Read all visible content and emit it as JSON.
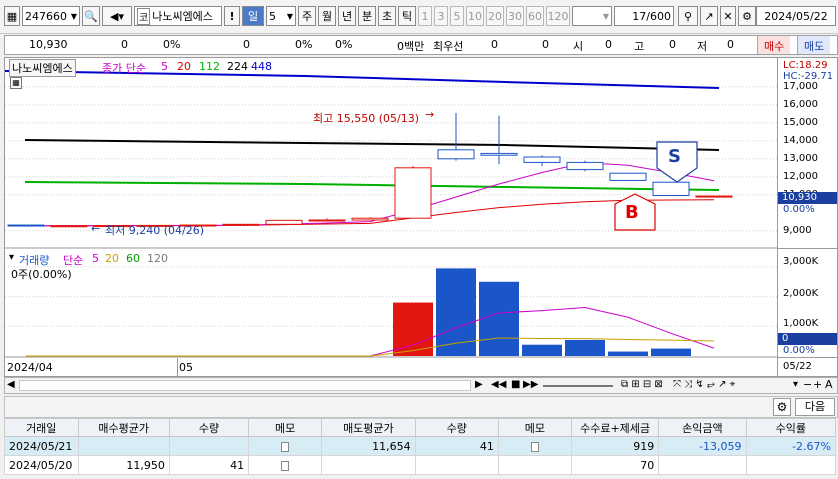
{
  "toolbar": {
    "code": "247660",
    "market": "코",
    "stock_name": "나노씨엠에스",
    "excl": "!",
    "period_sel": "일",
    "period_num": "5",
    "periods": [
      "주",
      "월",
      "년",
      "분",
      "초",
      "틱"
    ],
    "nums": [
      "1",
      "3",
      "5",
      "10",
      "20",
      "30",
      "60",
      "120"
    ],
    "count": "17",
    "count_total": "/600",
    "date": "2024/05/22"
  },
  "summary": {
    "price": "10,930",
    "v1": "0",
    "v2": "0%",
    "v3": "0",
    "v4": "0%",
    "v5": "0%",
    "v6": "0백만",
    "best": "최우선",
    "v7": "0",
    "v8": "0",
    "open_lbl": "시",
    "open": "0",
    "high_lbl": "고",
    "high": "0",
    "low_lbl": "저",
    "low": "0",
    "buy": "매수",
    "sell": "매도"
  },
  "price_panel": {
    "name": "나노씨엠에스",
    "legend_close": "종가 단순",
    "ma": [
      "5",
      "20",
      "112",
      "224",
      "448"
    ],
    "ma_colors": [
      "#cc00cc",
      "#e00000",
      "#00b000",
      "#000000",
      "#0000cc"
    ],
    "lc": "LC:18.29",
    "hc": "HC:-29.71",
    "high_note": "최고 15,550 (05/13)",
    "low_note": "최저 9,240 (04/26)",
    "b_mark": "B",
    "s_mark": "S",
    "current": "10,930",
    "current_pct": "0.00%",
    "axis": [
      "17,000",
      "16,000",
      "15,000",
      "14,000",
      "13,000",
      "12,000",
      "11,000",
      "9,000"
    ]
  },
  "volume_panel": {
    "legend_vol": "거래량",
    "legend_simple": "단순",
    "ma": [
      "5",
      "20",
      "60",
      "120"
    ],
    "ma_colors": [
      "#cc00cc",
      "#c8a000",
      "#00a000",
      "#7a7a7a"
    ],
    "sub": "0주(0.00%)",
    "axis": [
      "3,000K",
      "2,000K",
      "1,000K"
    ],
    "current": "0",
    "current_pct": "0.00%"
  },
  "xaxis": {
    "left": "2024/04",
    "mid": "05",
    "right": "05/22"
  },
  "bottom_toolbar": {
    "next_label": "다음"
  },
  "trades": {
    "headers": [
      "거래일",
      "매수평균가",
      "수량",
      "메모",
      "매도평균가",
      "수량",
      "메모",
      "수수료+제세금",
      "손익금액",
      "수익률"
    ],
    "rows": [
      {
        "date": "2024/05/21",
        "buy_avg": "",
        "buy_qty": "",
        "sell_avg": "11,654",
        "sell_qty": "41",
        "fee": "919",
        "pl": "-13,059",
        "rate": "-2.67%"
      },
      {
        "date": "2024/05/20",
        "buy_avg": "11,950",
        "buy_qty": "41",
        "sell_avg": "",
        "sell_qty": "",
        "fee": "70",
        "pl": "",
        "rate": ""
      }
    ]
  },
  "colors": {
    "up": "#e0160f",
    "down": "#1b56c8",
    "accent": "#c00000"
  },
  "chart_data": {
    "type": "candlestick",
    "candles": [
      {
        "o": 9320,
        "h": 9320,
        "l": 9240,
        "c": 9280
      },
      {
        "o": 9280,
        "h": 9300,
        "l": 9250,
        "c": 9280
      },
      {
        "o": 9280,
        "h": 9300,
        "l": 9260,
        "c": 9290
      },
      {
        "o": 9290,
        "h": 9320,
        "l": 9270,
        "c": 9300
      },
      {
        "o": 9300,
        "h": 9330,
        "l": 9280,
        "c": 9320
      },
      {
        "o": 9320,
        "h": 9380,
        "l": 9290,
        "c": 9360
      },
      {
        "o": 9360,
        "h": 9600,
        "l": 9350,
        "c": 9580
      },
      {
        "o": 9580,
        "h": 9700,
        "l": 9550,
        "c": 9600
      },
      {
        "o": 9600,
        "h": 9750,
        "l": 9580,
        "c": 9700
      },
      {
        "o": 9700,
        "h": 12600,
        "l": 9680,
        "c": 12500
      },
      {
        "o": 13500,
        "h": 15550,
        "l": 12900,
        "c": 13000
      },
      {
        "o": 13300,
        "h": 15400,
        "l": 12700,
        "c": 13200
      },
      {
        "o": 13100,
        "h": 13200,
        "l": 12600,
        "c": 12800
      },
      {
        "o": 12800,
        "h": 12900,
        "l": 12300,
        "c": 12400
      },
      {
        "o": 12200,
        "h": 12200,
        "l": 11800,
        "c": 11800
      },
      {
        "o": 11700,
        "h": 11700,
        "l": 10960,
        "c": 10960
      },
      {
        "o": 10930,
        "h": 10930,
        "l": 10930,
        "c": 10930
      }
    ],
    "volume_k": [
      0,
      0,
      0,
      0,
      0,
      0,
      0,
      0,
      5,
      1800,
      2950,
      2500,
      380,
      540,
      150,
      250,
      0
    ],
    "ylim": [
      8600,
      17600
    ],
    "vol_ylim": [
      0,
      3300
    ]
  }
}
